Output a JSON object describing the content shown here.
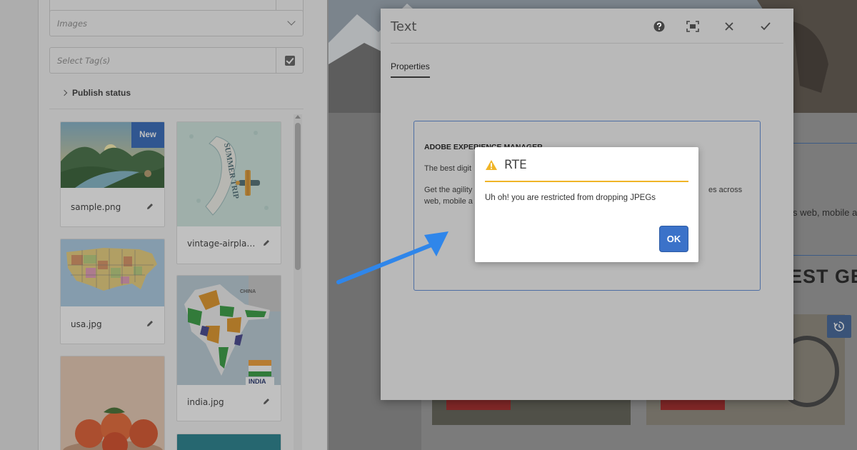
{
  "filters": {
    "images_select": "Images",
    "tags_placeholder": "Select Tag(s)",
    "publish_status": "Publish status"
  },
  "assets": [
    {
      "name": "sample.png",
      "badge": "New"
    },
    {
      "name": "vintage-airplan..."
    },
    {
      "name": "usa.jpg"
    },
    {
      "name": "india.jpg"
    }
  ],
  "thumb_text": {
    "summer_trip": "SUMMER TRIP",
    "china": "CHINA",
    "india_caption": "INDIA"
  },
  "dialog": {
    "title": "Text",
    "tab": "Properties",
    "toolbar_icons": [
      "help-icon",
      "fullscreen-icon",
      "close-icon",
      "checkmark-icon"
    ],
    "content": {
      "heading": "ADOBE EXPERIENCE MANAGER",
      "p1": "The best digit",
      "p2_line1": "Get the agility",
      "p2_line2": "web, mobile a",
      "p2_right": "es across"
    }
  },
  "alert": {
    "title": "RTE",
    "message": "Uh oh! you are restricted from dropping JPEGs",
    "ok_label": "OK",
    "warning_color": "#f0b528"
  },
  "background_page": {
    "partial_text": "s web, mobile a",
    "heading": "EST GEA"
  },
  "colors": {
    "accent_blue": "#3b72c9",
    "badge_blue": "#2b63b8",
    "annotation_arrow": "#2f86ea"
  }
}
